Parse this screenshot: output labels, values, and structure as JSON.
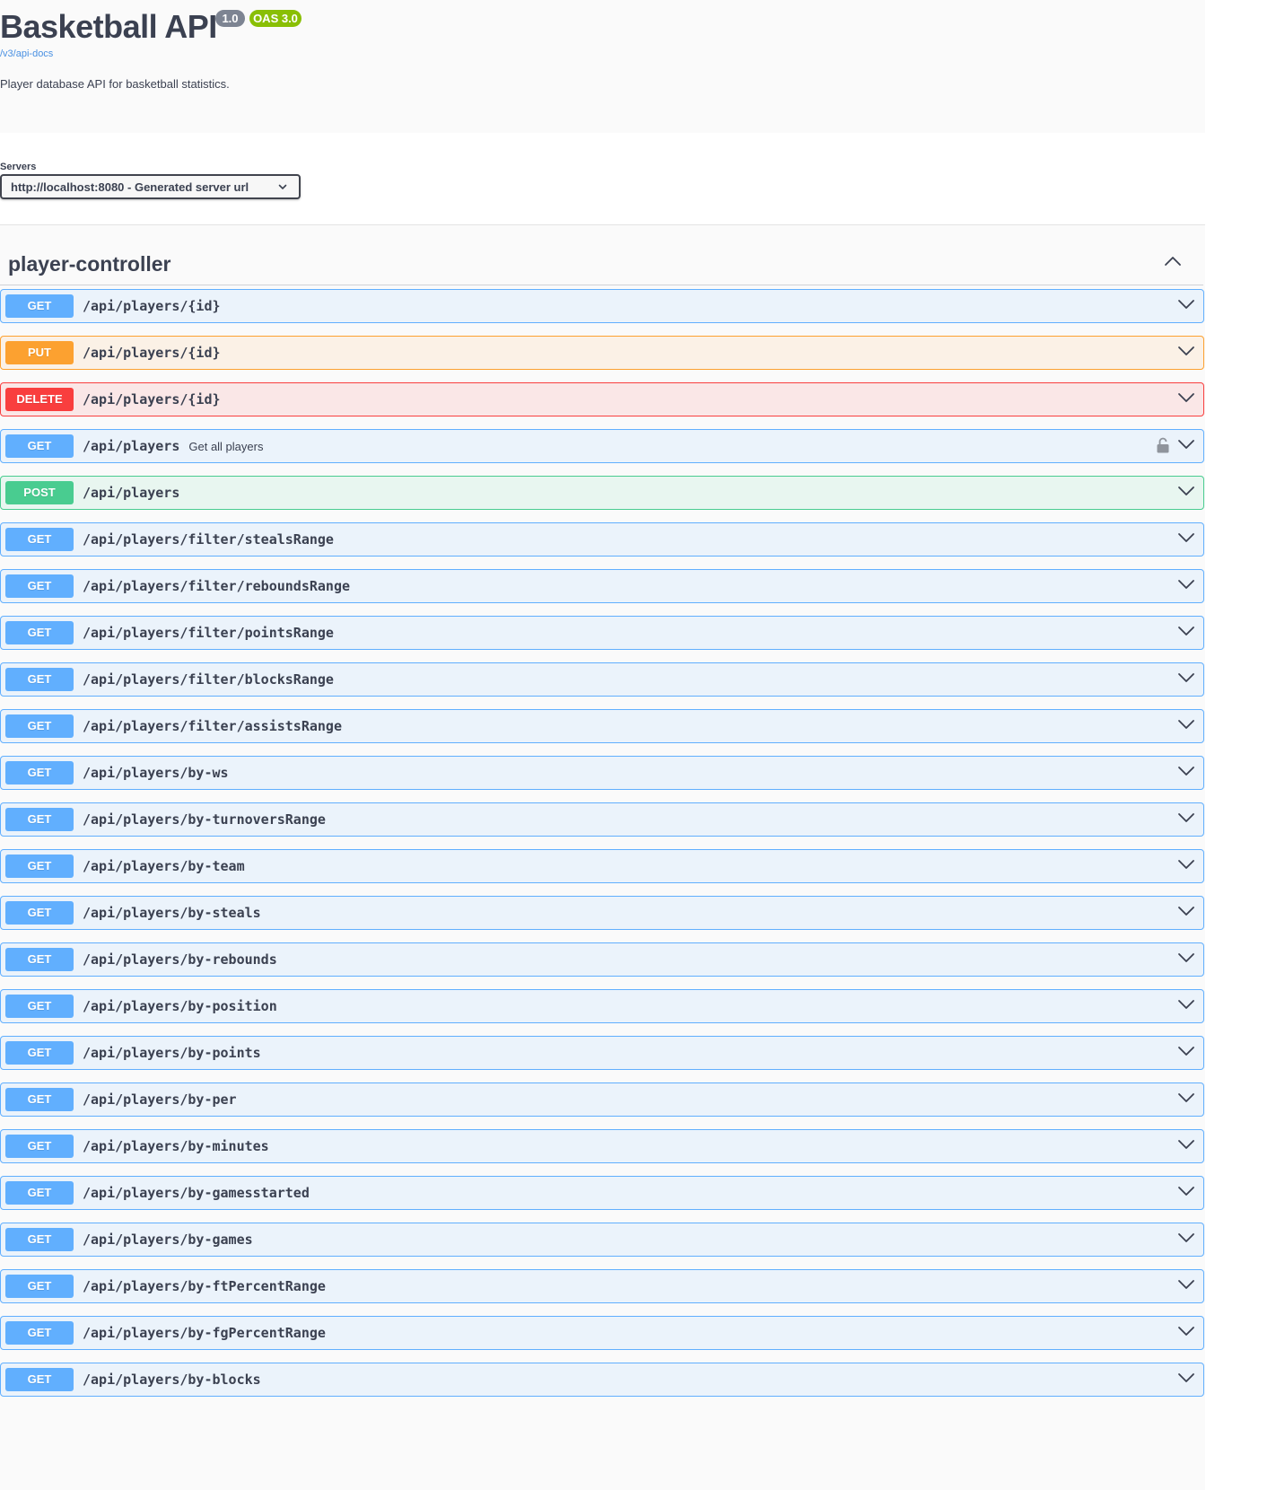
{
  "info": {
    "title": "Basketball API",
    "version": "1.0",
    "oas": "OAS 3.0",
    "docs_link": "/v3/api-docs",
    "description": "Player database API for basketball statistics."
  },
  "servers": {
    "label": "Servers",
    "selected": "http://localhost:8080 - Generated server url"
  },
  "tag": {
    "name": "player-controller",
    "expanded": true
  },
  "operations": [
    {
      "method": "GET",
      "path": "/api/players/{id}",
      "summary": ""
    },
    {
      "method": "PUT",
      "path": "/api/players/{id}",
      "summary": ""
    },
    {
      "method": "DELETE",
      "path": "/api/players/{id}",
      "summary": ""
    },
    {
      "method": "GET",
      "path": "/api/players",
      "summary": "Get all players",
      "locked": true
    },
    {
      "method": "POST",
      "path": "/api/players",
      "summary": ""
    },
    {
      "method": "GET",
      "path": "/api/players/filter/stealsRange",
      "summary": ""
    },
    {
      "method": "GET",
      "path": "/api/players/filter/reboundsRange",
      "summary": ""
    },
    {
      "method": "GET",
      "path": "/api/players/filter/pointsRange",
      "summary": ""
    },
    {
      "method": "GET",
      "path": "/api/players/filter/blocksRange",
      "summary": ""
    },
    {
      "method": "GET",
      "path": "/api/players/filter/assistsRange",
      "summary": ""
    },
    {
      "method": "GET",
      "path": "/api/players/by-ws",
      "summary": ""
    },
    {
      "method": "GET",
      "path": "/api/players/by-turnoversRange",
      "summary": ""
    },
    {
      "method": "GET",
      "path": "/api/players/by-team",
      "summary": ""
    },
    {
      "method": "GET",
      "path": "/api/players/by-steals",
      "summary": ""
    },
    {
      "method": "GET",
      "path": "/api/players/by-rebounds",
      "summary": ""
    },
    {
      "method": "GET",
      "path": "/api/players/by-position",
      "summary": ""
    },
    {
      "method": "GET",
      "path": "/api/players/by-points",
      "summary": ""
    },
    {
      "method": "GET",
      "path": "/api/players/by-per",
      "summary": ""
    },
    {
      "method": "GET",
      "path": "/api/players/by-minutes",
      "summary": ""
    },
    {
      "method": "GET",
      "path": "/api/players/by-gamesstarted",
      "summary": ""
    },
    {
      "method": "GET",
      "path": "/api/players/by-games",
      "summary": ""
    },
    {
      "method": "GET",
      "path": "/api/players/by-ftPercentRange",
      "summary": ""
    },
    {
      "method": "GET",
      "path": "/api/players/by-fgPercentRange",
      "summary": ""
    },
    {
      "method": "GET",
      "path": "/api/players/by-blocks",
      "summary": ""
    }
  ],
  "colors": {
    "get": "#61affe",
    "put": "#fca130",
    "delete": "#f93e3e",
    "post": "#49cc90",
    "text": "#3b4151",
    "link": "#4990e2",
    "version_badge": "#7d8492",
    "oas_badge": "#89bf04"
  }
}
